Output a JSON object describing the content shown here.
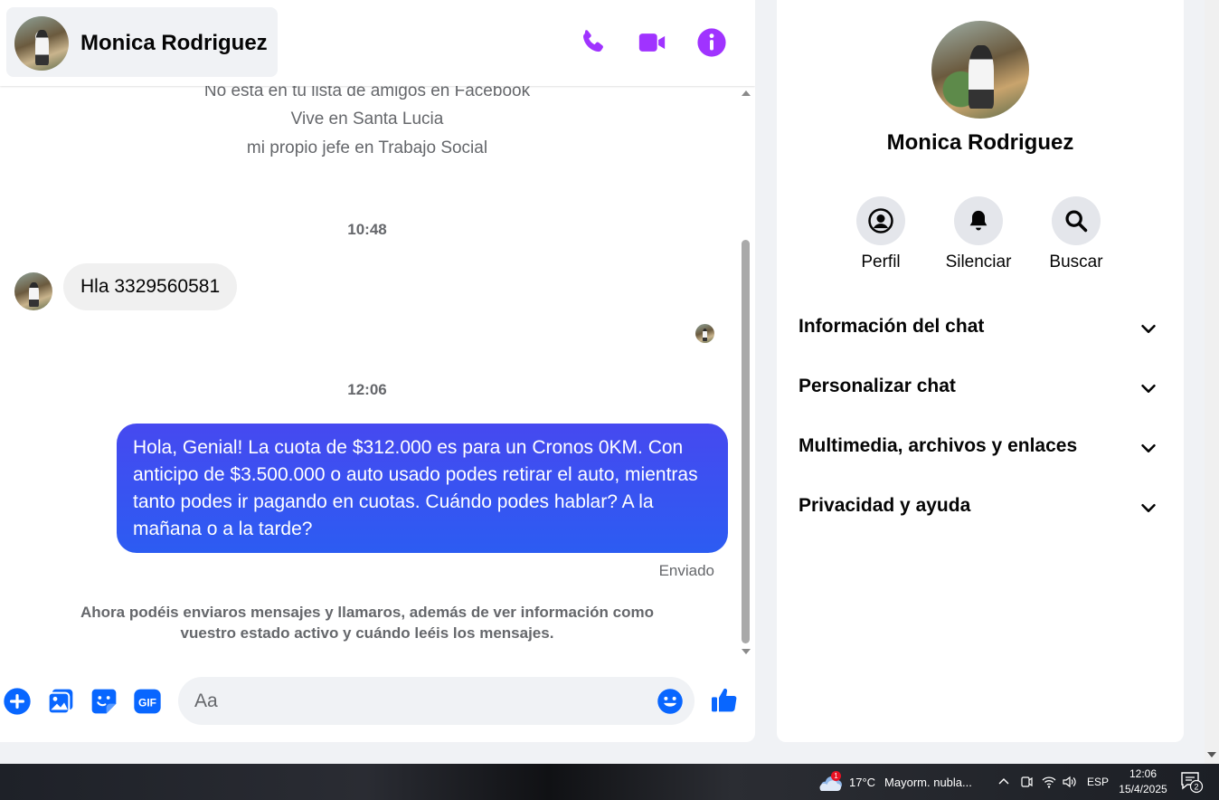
{
  "header": {
    "contact_name": "Monica Rodriguez",
    "icons": [
      "phone-icon",
      "video-camera-icon",
      "info-icon"
    ]
  },
  "profile_info": {
    "friend_status": "No esta en tu lista de amigos en Facebook",
    "lives_in": "Vive en Santa Lucia",
    "work": "mi propio jefe en Trabajo Social"
  },
  "messages": [
    {
      "time": "10:48",
      "direction": "incoming",
      "text": "Hla 3329560581"
    },
    {
      "time": "12:06",
      "direction": "outgoing",
      "text": "Hola, Genial! La cuota de $312.000 es para un Cronos 0KM. Con anticipo de $3.500.000 o auto usado podes retirar el auto, mientras tanto podes ir pagando en cuotas. Cuándo podes hablar? A la mañana o a la tarde?",
      "status": "Enviado"
    }
  ],
  "notice": "Ahora podéis enviaros mensajes y llamaros, además de ver información como vuestro estado activo y cuándo leéis los mensajes.",
  "composer": {
    "placeholder": "Aa",
    "gif_label": "GIF"
  },
  "info_panel": {
    "name": "Monica Rodriguez",
    "actions": [
      {
        "label": "Perfil",
        "icon": "profile-icon"
      },
      {
        "label": "Silenciar",
        "icon": "bell-icon"
      },
      {
        "label": "Buscar",
        "icon": "search-icon"
      }
    ],
    "sections": [
      {
        "title": "Información del chat"
      },
      {
        "title": "Personalizar chat"
      },
      {
        "title": "Multimedia, archivos y enlaces"
      },
      {
        "title": "Privacidad y ayuda"
      }
    ]
  },
  "taskbar": {
    "weather_badge": "1",
    "temperature": "17°C",
    "weather_text": "Mayorm. nubla...",
    "language": "ESP",
    "time": "12:06",
    "date": "15/4/2025",
    "notifications": "2"
  },
  "colors": {
    "accent": "#a033ff",
    "messenger_blue": "#0866ff",
    "bubble_out_top": "#4649f0",
    "bubble_out_bottom": "#2c5cf2"
  }
}
